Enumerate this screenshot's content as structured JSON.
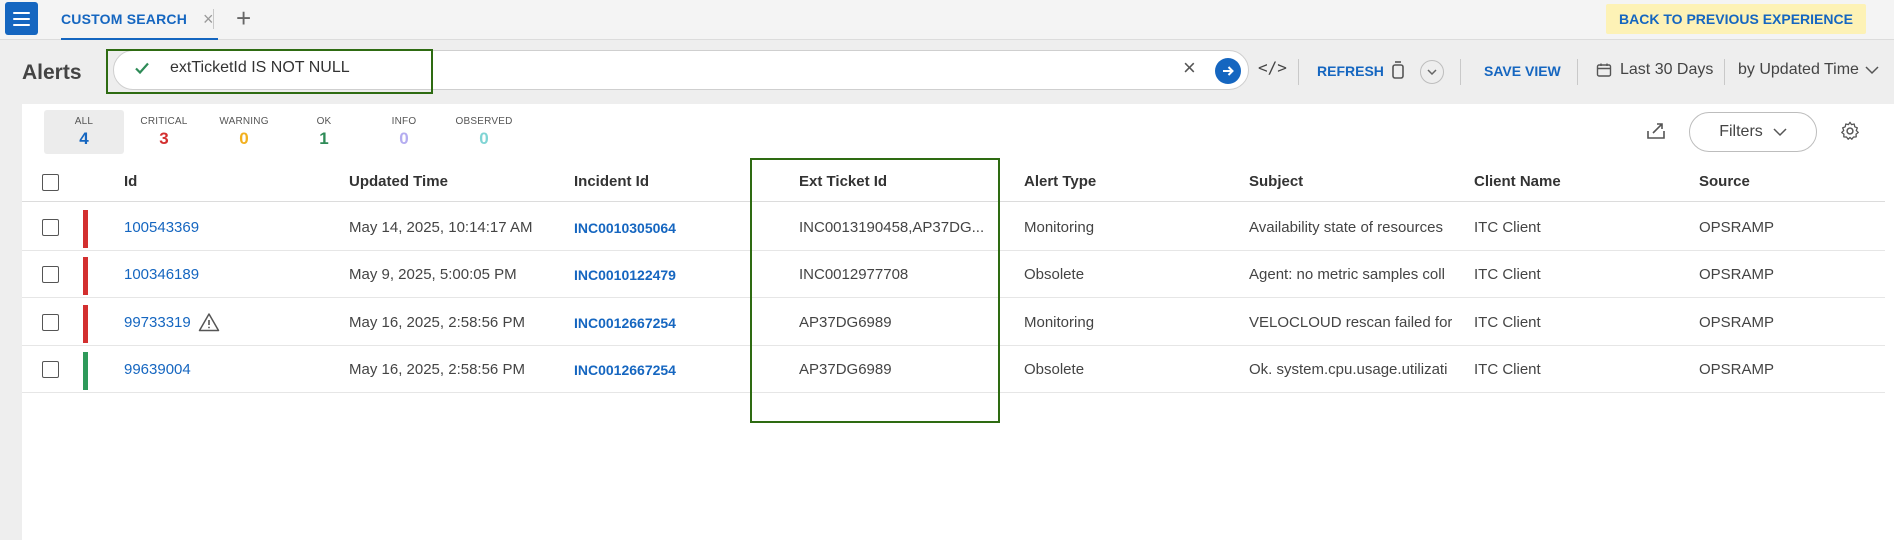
{
  "topbar": {
    "tab_label": "CUSTOM SEARCH",
    "back_label": "BACK TO PREVIOUS EXPERIENCE"
  },
  "search": {
    "page_title": "Alerts",
    "query": "extTicketId IS NOT NULL",
    "refresh_label": "REFRESH",
    "save_view_label": "SAVE VIEW",
    "date_range": "Last 30 Days",
    "sort_by": "by Updated Time"
  },
  "summary": [
    {
      "label": "ALL",
      "count": "4",
      "color": "#1566c0"
    },
    {
      "label": "CRITICAL",
      "count": "3",
      "color": "#d32f2f"
    },
    {
      "label": "WARNING",
      "count": "0",
      "color": "#f2b01e"
    },
    {
      "label": "OK",
      "count": "1",
      "color": "#2e8b57"
    },
    {
      "label": "INFO",
      "count": "0",
      "color": "#b4acf0"
    },
    {
      "label": "OBSERVED",
      "count": "0",
      "color": "#7fd4d4"
    }
  ],
  "toolbar": {
    "filters_label": "Filters"
  },
  "table": {
    "columns": [
      "Id",
      "Updated Time",
      "Incident Id",
      "Ext Ticket Id",
      "Alert Type",
      "Subject",
      "Client Name",
      "Source"
    ],
    "rows": [
      {
        "id": "100543369",
        "updated": "May 14, 2025, 10:14:17 AM",
        "incident": "INC0010305064",
        "ext": "INC0013190458,AP37DG...",
        "type": "Monitoring",
        "subject": "Availability state of resources",
        "client": "ITC Client",
        "source": "OPSRAMP",
        "severity_color": "#d32f2f"
      },
      {
        "id": "100346189",
        "updated": "May 9, 2025, 5:00:05 PM",
        "incident": "INC0010122479",
        "ext": "INC0012977708",
        "type": "Obsolete",
        "subject": "Agent: no metric samples coll",
        "client": "ITC Client",
        "source": "OPSRAMP",
        "severity_color": "#d32f2f"
      },
      {
        "id": "99733319",
        "updated": "May 16, 2025, 2:58:56 PM",
        "incident": "INC0012667254",
        "ext": "AP37DG6989",
        "type": "Monitoring",
        "subject": "VELOCLOUD rescan failed for",
        "client": "ITC Client",
        "source": "OPSRAMP",
        "severity_color": "#d32f2f"
      },
      {
        "id": "99639004",
        "updated": "May 16, 2025, 2:58:56 PM",
        "incident": "INC0012667254",
        "ext": "AP37DG6989",
        "type": "Obsolete",
        "subject": "Ok. system.cpu.usage.utilizati",
        "client": "ITC Client",
        "source": "OPSRAMP",
        "severity_color": "#2e9a5a"
      }
    ]
  },
  "colors": {
    "accent": "#1566c0",
    "highlight_border": "#2e6b12",
    "back_button_bg": "#fdf2b6"
  }
}
